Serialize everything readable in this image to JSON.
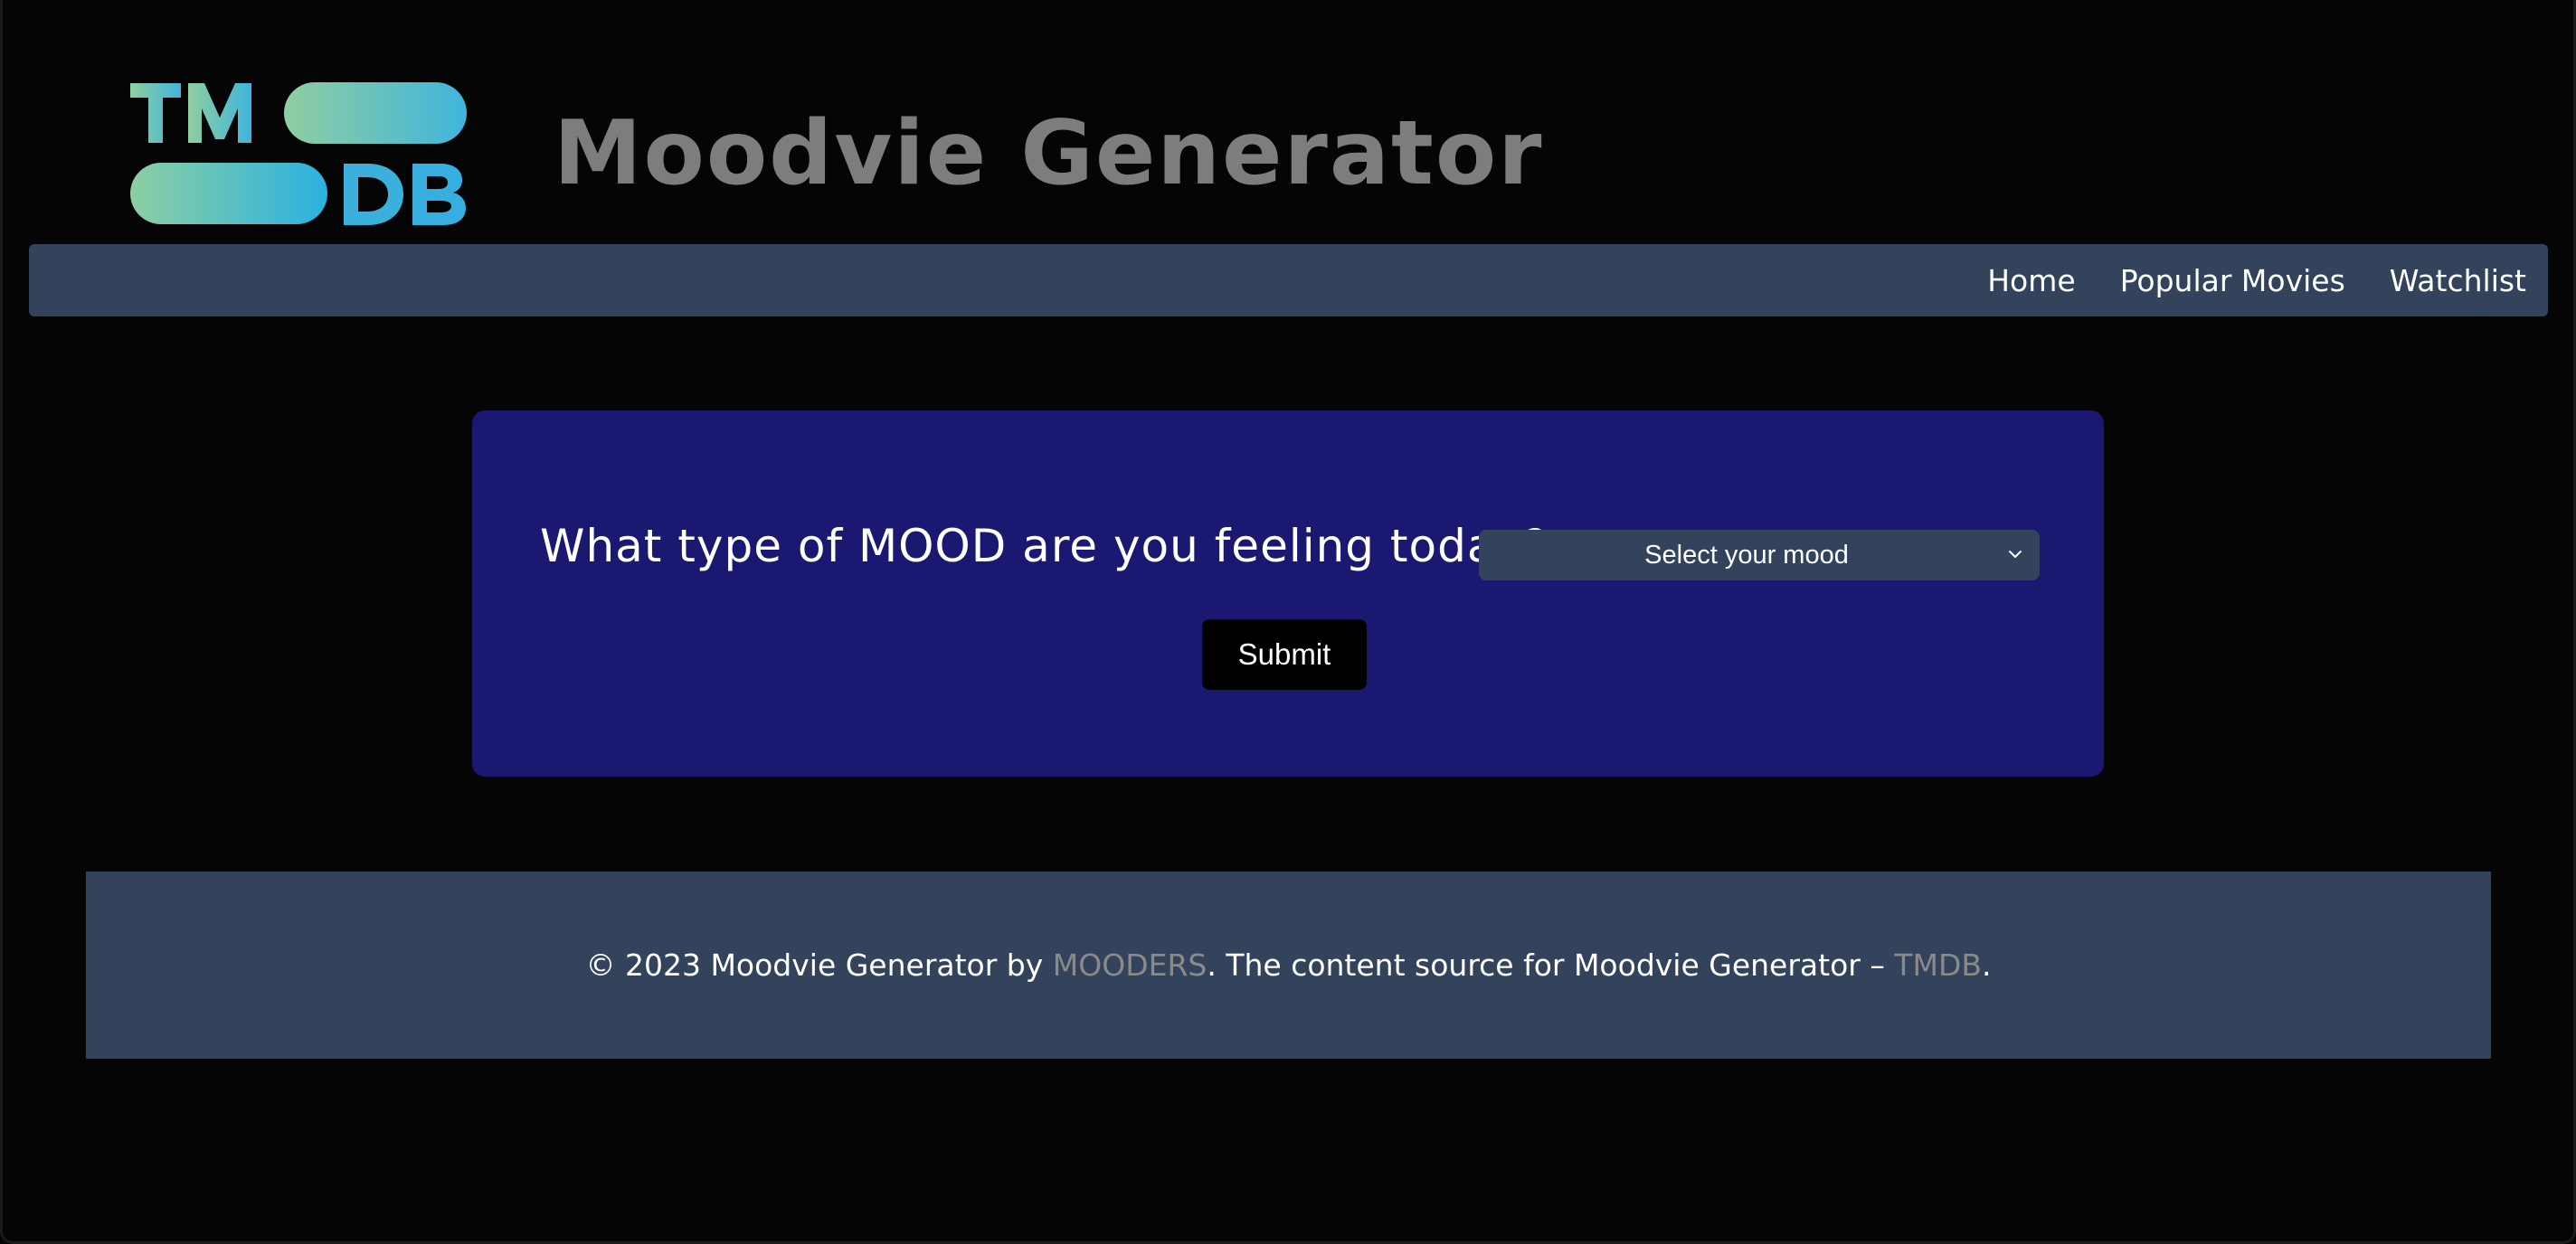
{
  "header": {
    "logo_text": "TMDB",
    "title": "Moodvie Generator"
  },
  "nav": {
    "items": [
      {
        "label": "Home"
      },
      {
        "label": "Popular Movies"
      },
      {
        "label": "Watchlist"
      }
    ]
  },
  "mood_form": {
    "question": "What type of MOOD are you feeling today?",
    "select_placeholder": "Select your mood",
    "submit_label": "Submit"
  },
  "footer": {
    "text_part1": "© 2023 Moodvie Generator by ",
    "author_link": "MOODERS",
    "text_part2": ". The content source for Moodvie Generator – ",
    "source_link": "TMDB",
    "text_part3": "."
  },
  "colors": {
    "background": "#050505",
    "navbar": "#32435b",
    "card": "#1a1870",
    "title": "#7d7d7d",
    "footer_link": "#8a8a8a",
    "logo_gradient_start": "#90cea1",
    "logo_gradient_end": "#01b4e4"
  },
  "icons": {
    "select_arrow": "chevron-down-icon"
  }
}
